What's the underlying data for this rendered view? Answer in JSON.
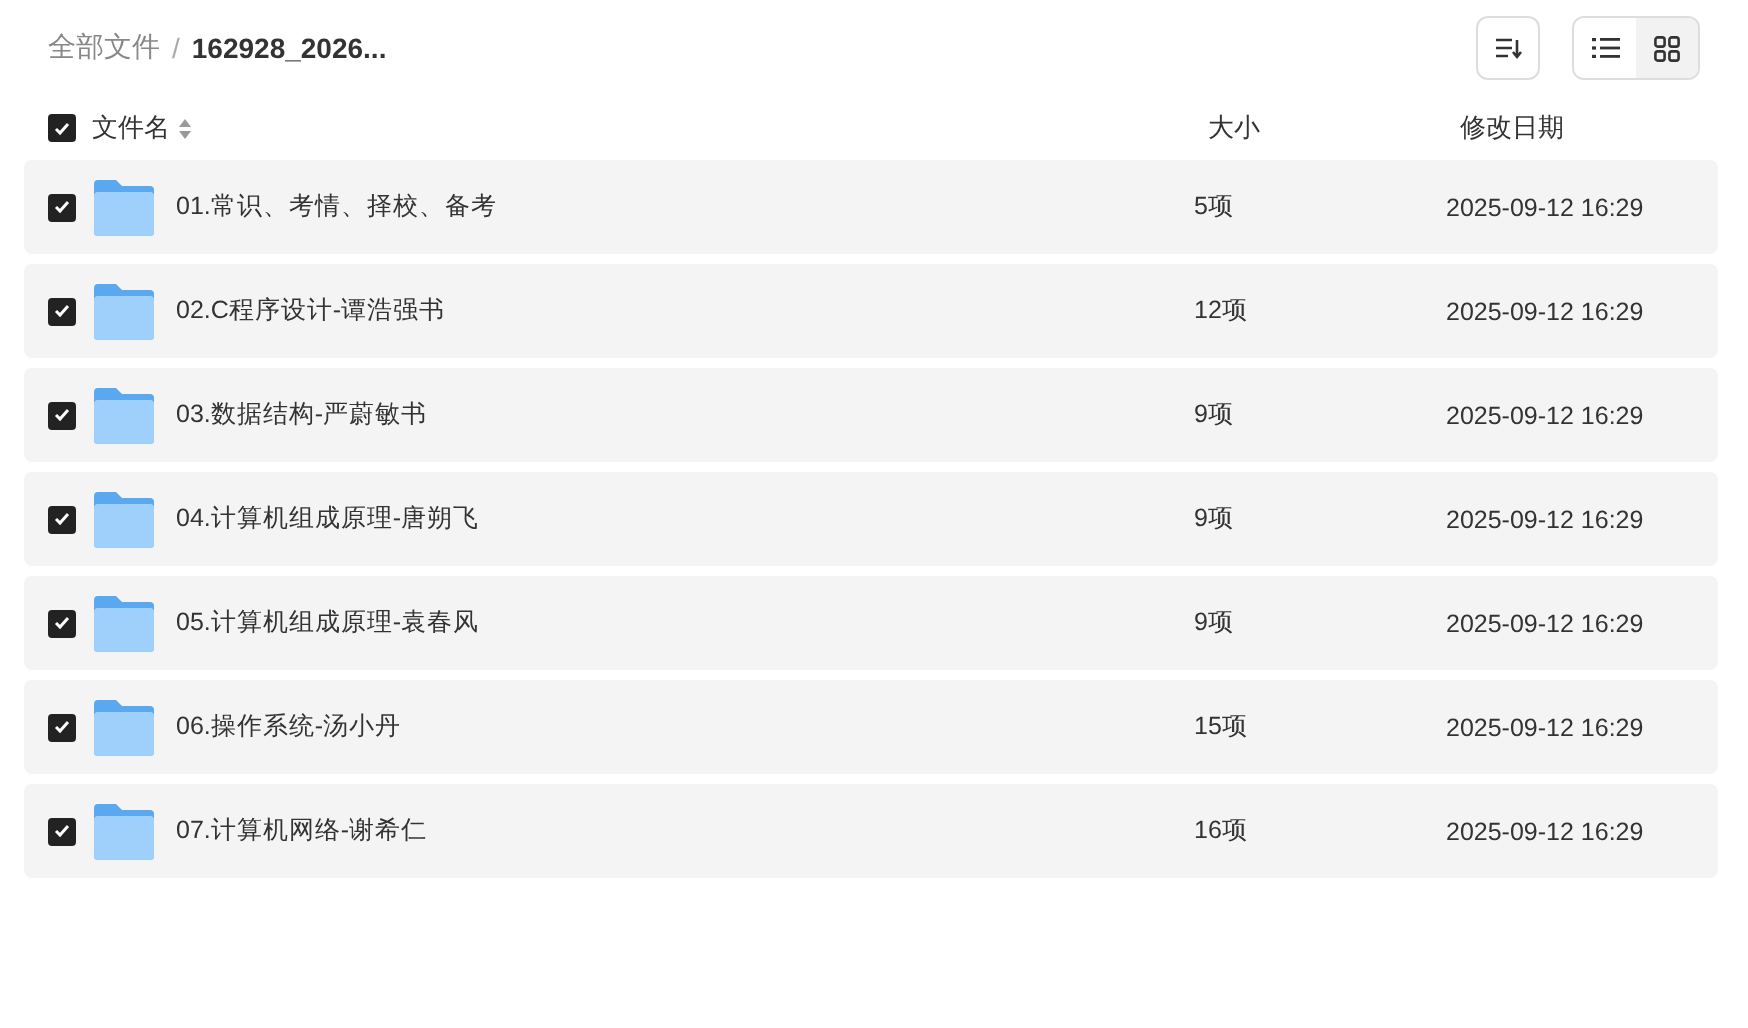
{
  "breadcrumb_separator": "/",
  "breadcrumb": [
    {
      "label": "全部文件",
      "current": false
    },
    {
      "label": "162928_2026...",
      "current": true
    }
  ],
  "toolbar": {
    "view_options": [
      {
        "kind": "list",
        "selected": true
      },
      {
        "kind": "grid",
        "selected": false
      }
    ]
  },
  "table": {
    "select_all": {
      "checked": true
    },
    "columns": [
      "文件名",
      "大小",
      "修改日期"
    ],
    "rows": [
      {
        "name": "01.常识、考情、择校、备考",
        "size": "5项",
        "modified": "2025-09-12 16:29",
        "checked": true
      },
      {
        "name": "02.C程序设计-谭浩强书",
        "size": "12项",
        "modified": "2025-09-12 16:29",
        "checked": true
      },
      {
        "name": "03.数据结构-严蔚敏书",
        "size": "9项",
        "modified": "2025-09-12 16:29",
        "checked": true
      },
      {
        "name": "04.计算机组成原理-唐朔飞",
        "size": "9项",
        "modified": "2025-09-12 16:29",
        "checked": true
      },
      {
        "name": "05.计算机组成原理-袁春风",
        "size": "9项",
        "modified": "2025-09-12 16:29",
        "checked": true
      },
      {
        "name": "06.操作系统-汤小丹",
        "size": "15项",
        "modified": "2025-09-12 16:29",
        "checked": true
      },
      {
        "name": "07.计算机网络-谢希仁",
        "size": "16项",
        "modified": "2025-09-12 16:29",
        "checked": true
      }
    ]
  }
}
